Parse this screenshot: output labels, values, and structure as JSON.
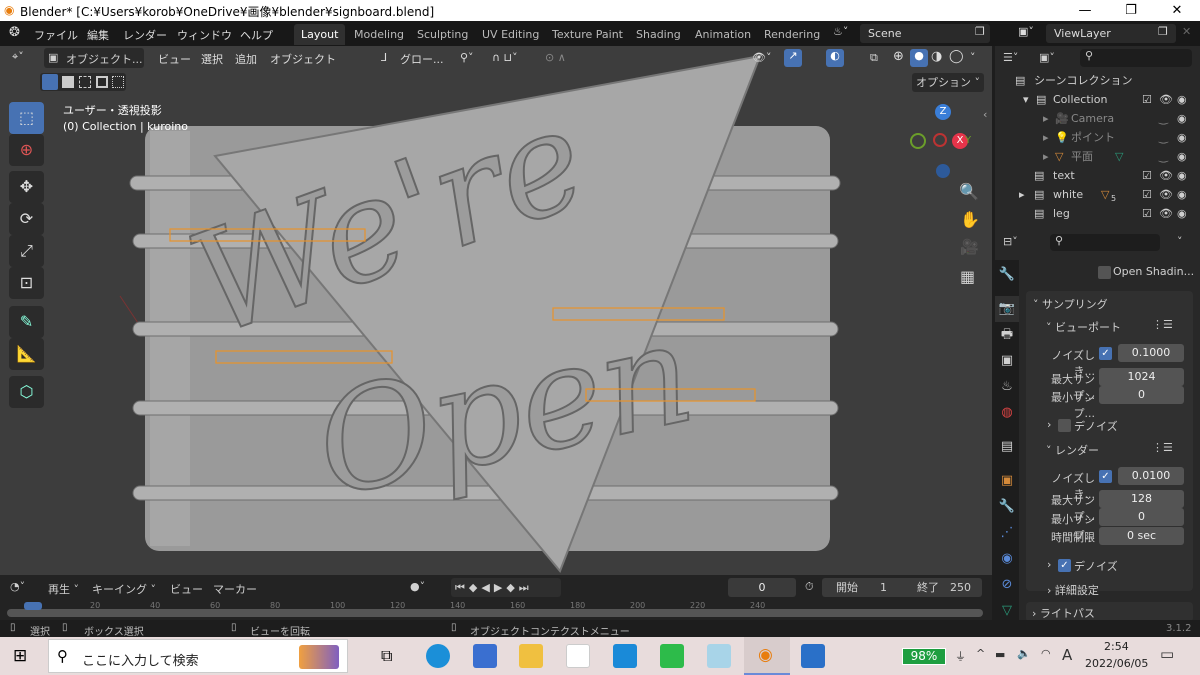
{
  "window": {
    "title": "Blender* [C:¥Users¥korob¥OneDrive¥画像¥blender¥signboard.blend]",
    "minimize": "—",
    "maximize": "❐",
    "close": "✕"
  },
  "menu": [
    "ファイル",
    "編集",
    "レンダー",
    "ウィンドウ",
    "ヘルプ"
  ],
  "workspaces": [
    {
      "label": "Layout",
      "active": true
    },
    {
      "label": "Modeling"
    },
    {
      "label": "Sculpting"
    },
    {
      "label": "UV Editing"
    },
    {
      "label": "Texture Paint"
    },
    {
      "label": "Shading"
    },
    {
      "label": "Animation"
    },
    {
      "label": "Rendering"
    }
  ],
  "scene": {
    "name": "Scene",
    "view_layer": "ViewLayer"
  },
  "viewport": {
    "mode": "オブジェクト...",
    "menus": [
      "ビュー",
      "選択",
      "追加",
      "オブジェクト"
    ],
    "transform_orientation": "グロー...",
    "options": "オプション",
    "overlay_line1": "ユーザー・透視投影",
    "overlay_line2": "(0) Collection | kuroino",
    "scene_text": {
      "line1": "We're",
      "line2": "Open"
    },
    "gizmo": {
      "x": "X",
      "y": "Y",
      "z": "Z",
      "x_color": "#e5344a",
      "y_color": "#6b9e2a",
      "z_color": "#3a7ed8"
    }
  },
  "outliner": {
    "root": "シーンコレクション",
    "items": [
      {
        "name": "Collection",
        "level": 0,
        "expanded": true
      },
      {
        "name": "Camera",
        "level": 1,
        "dim": true
      },
      {
        "name": "ポイント",
        "level": 1,
        "dim": true
      },
      {
        "name": "平面",
        "level": 1,
        "dim": true
      },
      {
        "name": "text",
        "level": 0
      },
      {
        "name": "white",
        "level": 0,
        "badge": "5"
      },
      {
        "name": "leg",
        "level": 0
      }
    ]
  },
  "properties": {
    "open_shading": "Open Shadin...",
    "sampling": "サンプリング",
    "viewport": {
      "title": "ビューポート",
      "noise_label": "ノイズしき...",
      "noise": "0.1000",
      "max_label": "最大サンプ...",
      "max": "1024",
      "min_label": "最小サンプ...",
      "min": "0",
      "denoise": "デノイズ"
    },
    "render": {
      "title": "レンダー",
      "noise_label": "ノイズしき...",
      "noise": "0.0100",
      "max_label": "最大サンプ...",
      "max": "128",
      "min_label": "最小サンプ...",
      "min": "0",
      "time_label": "時間制限",
      "time": "0 sec",
      "denoise": "デノイズ",
      "advanced": "詳細設定"
    },
    "light_paths": "ライトパス"
  },
  "timeline": {
    "playback": "再生",
    "keying": "キーイング",
    "view": "ビュー",
    "marker": "マーカー",
    "current_frame": "0",
    "start_label": "開始",
    "start": "1",
    "end_label": "終了",
    "end": "250",
    "ticks": [
      "0",
      "20",
      "40",
      "60",
      "80",
      "100",
      "120",
      "140",
      "160",
      "180",
      "200",
      "220",
      "240"
    ]
  },
  "statusbar": {
    "select": "選択",
    "box_select": "ボックス選択",
    "rotate": "ビューを回転",
    "context_menu": "オブジェクトコンテクストメニュー",
    "version": "3.1.2"
  },
  "taskbar": {
    "search_placeholder": "ここに入力して検索",
    "battery": "98%",
    "ime": "A",
    "time": "2:54",
    "date": "2022/06/05"
  }
}
